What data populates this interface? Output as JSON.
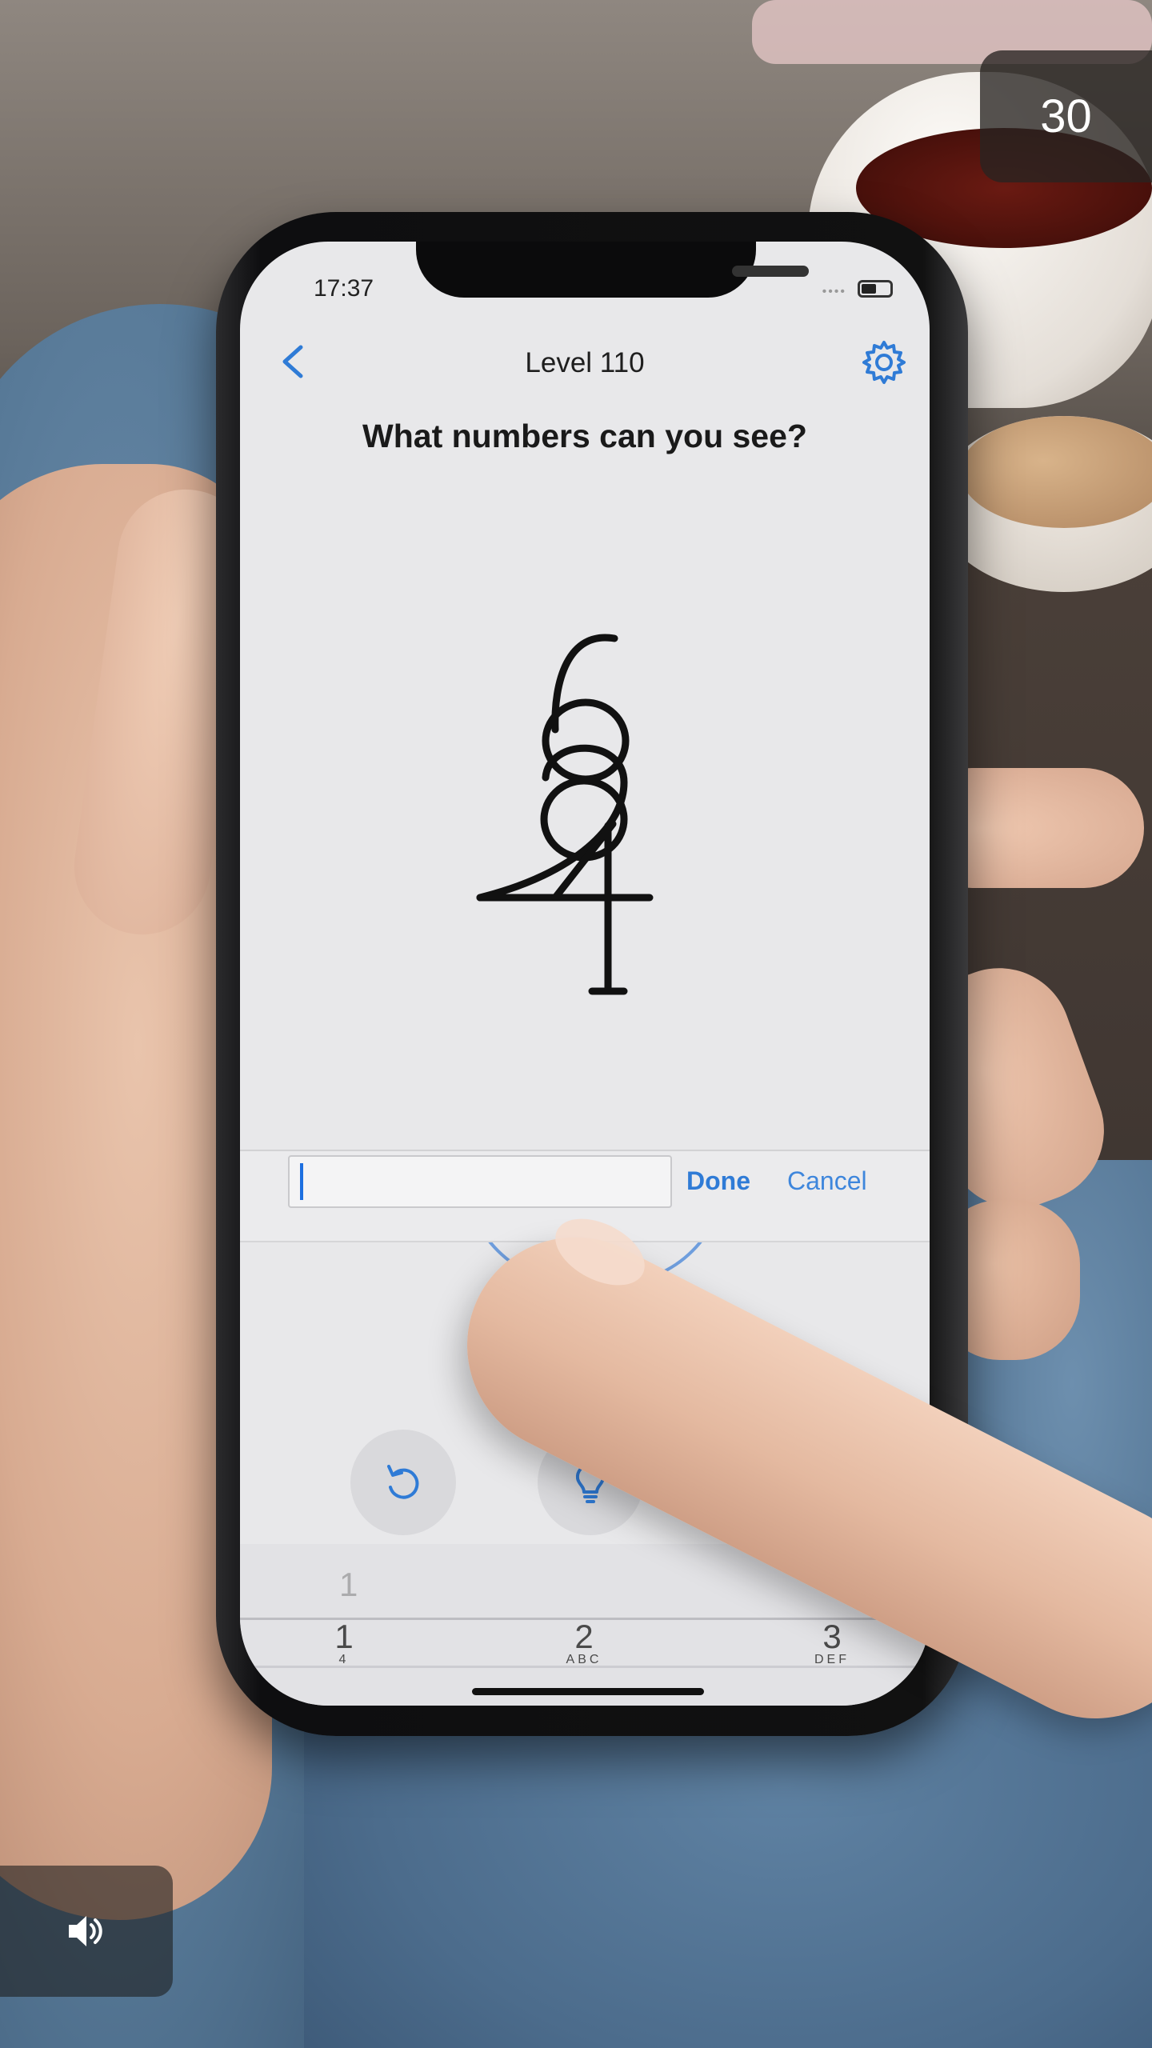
{
  "overlay": {
    "counter": "30",
    "sound_icon": "speaker-icon"
  },
  "phone": {
    "status_time": "17:37",
    "nav": {
      "title": "Level 110",
      "back_icon": "chevron-left-icon",
      "settings_icon": "gear-icon"
    },
    "question": "What numbers can you see?",
    "puzzle": {
      "description_digits": [
        "6",
        "8",
        "2",
        "4",
        "1"
      ]
    },
    "answer_bar": {
      "value": "",
      "done_label": "Done",
      "cancel_label": "Cancel"
    },
    "tools": [
      {
        "icon": "undo-icon"
      },
      {
        "icon": "lightbulb-icon",
        "badge_icon": "eye-icon"
      },
      {
        "icon": "skip-icon"
      }
    ],
    "keypad": {
      "keys": [
        {
          "num": "1",
          "sub": ""
        },
        {
          "num": "2",
          "sub": "ABC"
        },
        {
          "num": "3",
          "sub": "DEF"
        }
      ],
      "ghost_digits": [
        "1",
        "4"
      ]
    },
    "colors": {
      "accent": "#2f7bd6",
      "background": "#e8e8ea"
    }
  }
}
